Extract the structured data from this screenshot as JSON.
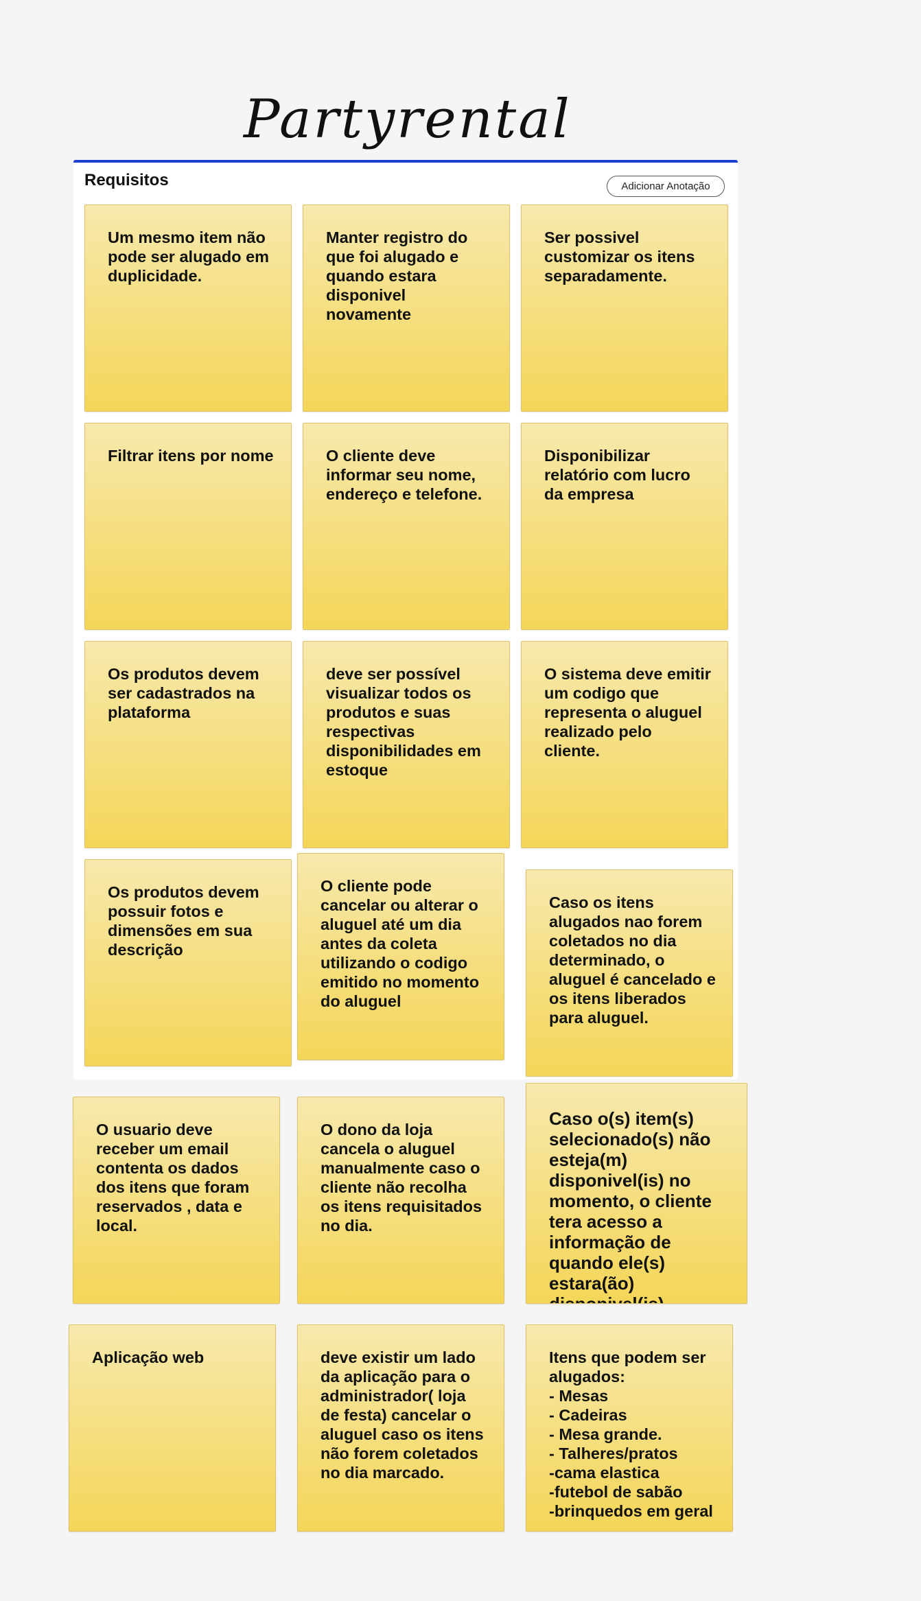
{
  "title": "Partyrental",
  "board": {
    "heading": "Requisitos",
    "add_button_label": "Adicionar Anotação"
  },
  "notes": [
    "Um mesmo item não pode ser alugado em duplicidade.",
    "Manter registro do que foi alugado e quando estara disponivel novamente",
    "Ser possivel customizar os itens separadamente.",
    "Filtrar itens por nome",
    "O cliente deve informar seu nome, endereço e telefone.",
    "Disponibilizar relatório com lucro da empresa",
    "Os produtos devem ser cadastrados na plataforma",
    "deve ser possível visualizar todos os produtos e suas respectivas disponibilidades em estoque",
    "O sistema deve emitir um codigo que representa o aluguel realizado pelo cliente.",
    "Os produtos devem possuir fotos e dimensões em sua descrição",
    "O cliente pode cancelar ou alterar o aluguel até um dia antes da coleta utilizando o codigo emitido no momento do aluguel",
    "Caso os itens alugados nao forem coletados no dia determinado, o aluguel é cancelado e os itens liberados para aluguel.",
    "O usuario deve receber um email contenta os dados dos itens que foram reservados , data e local.",
    "O dono da loja cancela o aluguel manualmente caso o cliente não recolha os itens requisitados no dia.",
    "Caso o(s) item(s) selecionado(s) não esteja(m) disponivel(is) no momento, o cliente tera acesso a informação de quando ele(s) estara(ão) disponivel(is)",
    "Aplicação web",
    "deve existir um lado da aplicação para o administrador( loja de festa) cancelar o aluguel caso os itens não forem coletados no dia marcado.",
    "Itens que podem ser alugados:\n- Mesas\n- Cadeiras\n- Mesa grande.\n- Talheres/pratos\n-cama elastica\n-futebol de sabão\n-brinquedos em geral"
  ]
}
